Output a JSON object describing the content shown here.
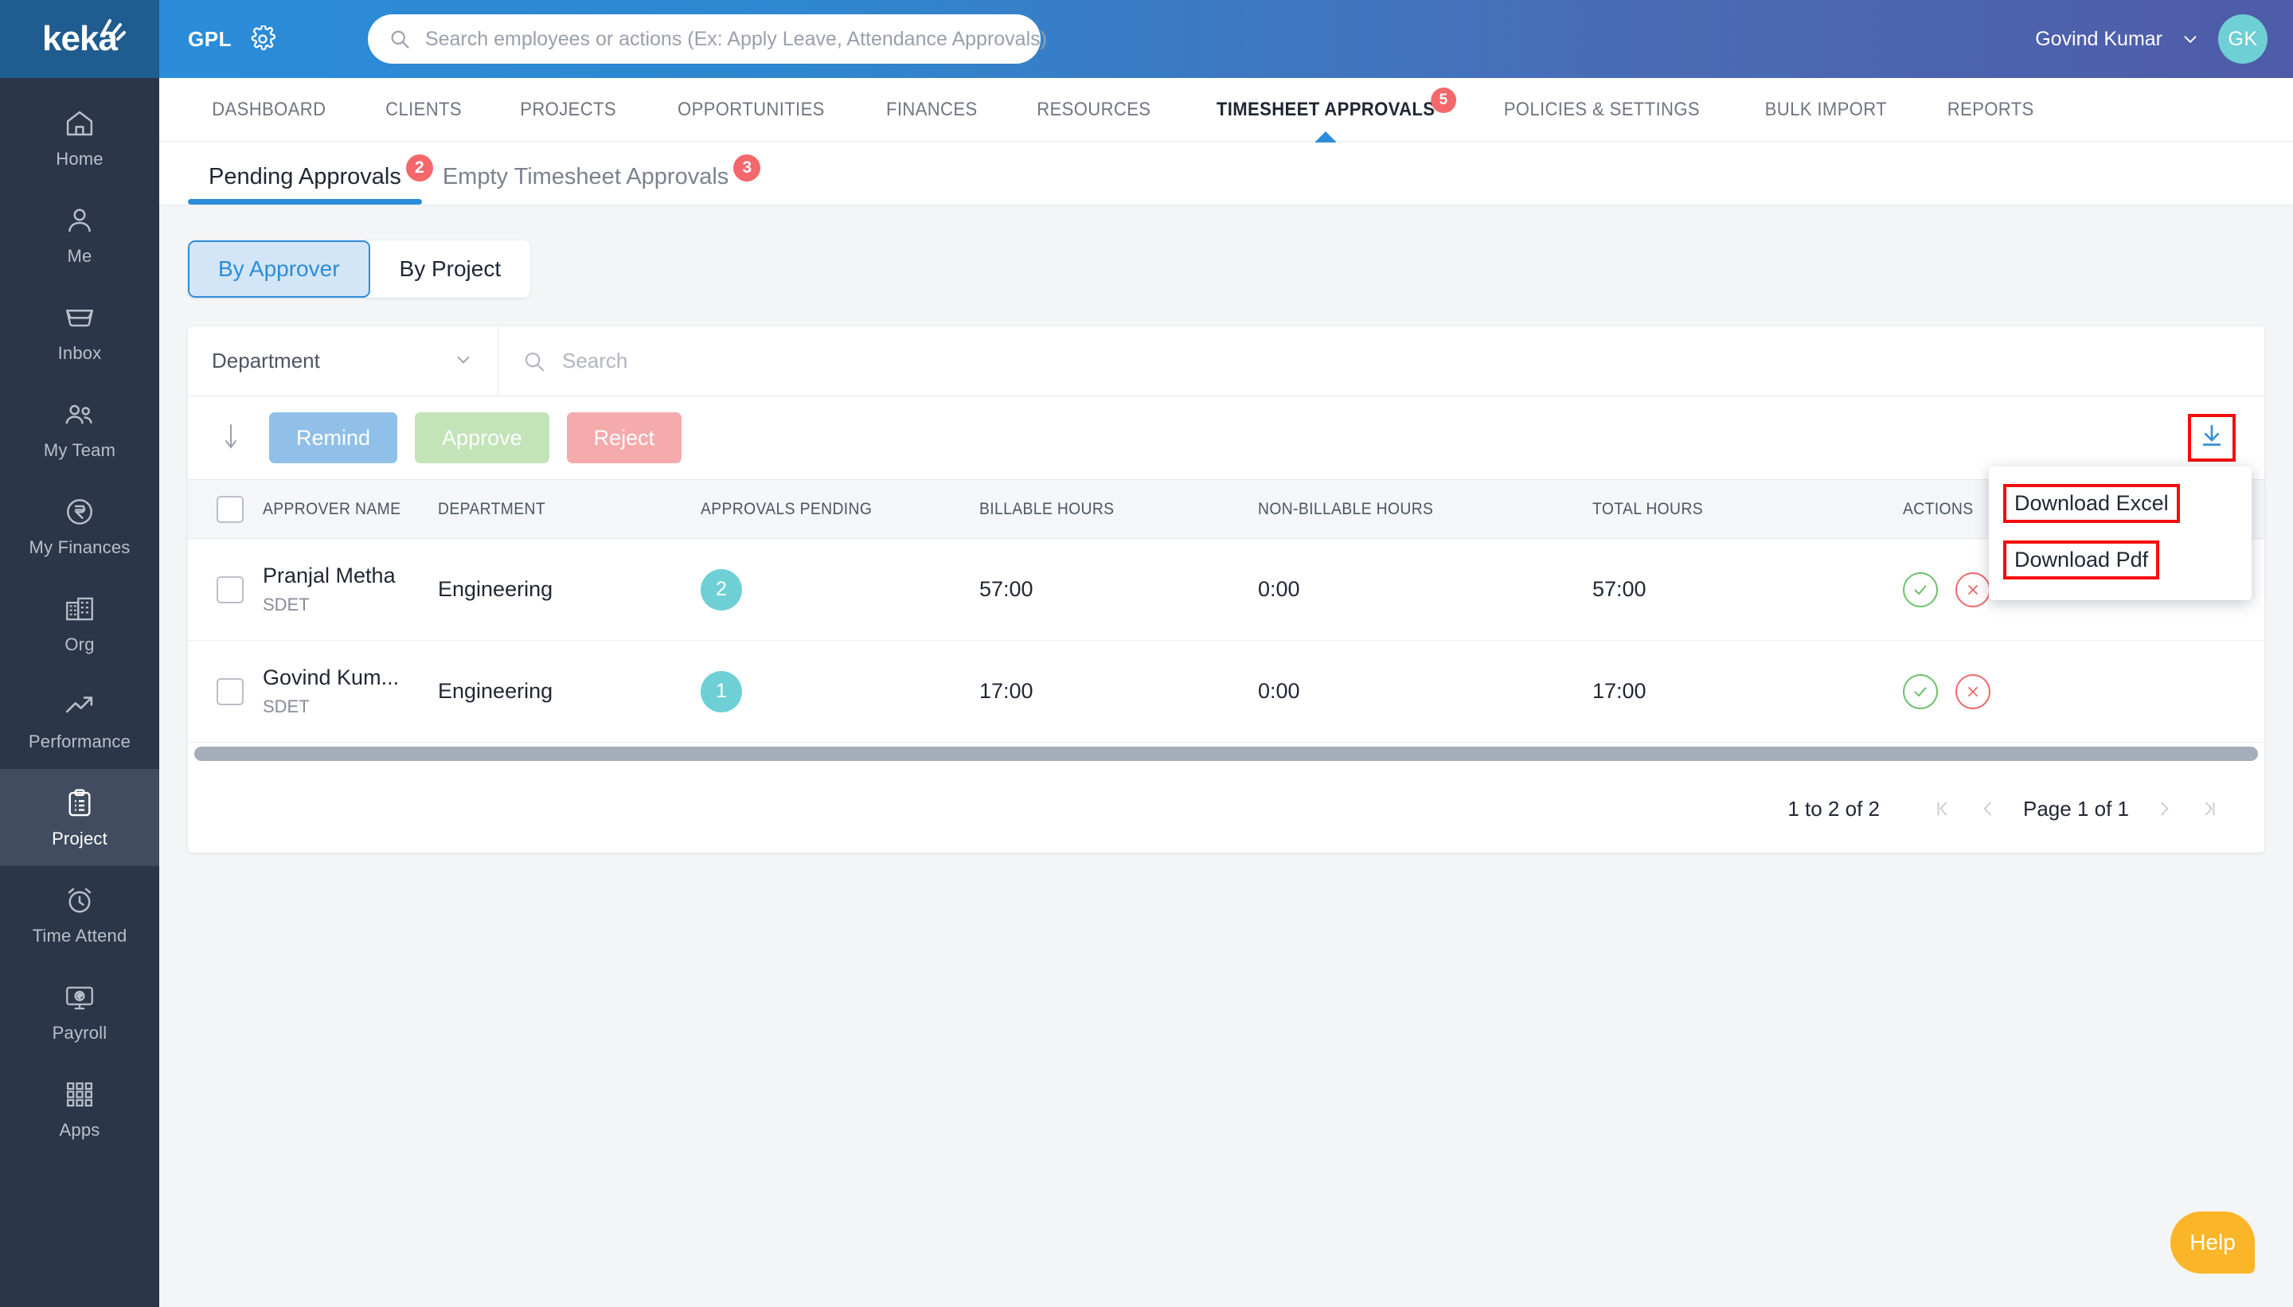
{
  "brand": {
    "logo_text": "keka",
    "org_code": "GPL",
    "gear_icon": "gear-icon"
  },
  "header": {
    "search_placeholder": "Search employees or actions (Ex: Apply Leave, Attendance Approvals)",
    "search_icon": "search-icon",
    "user_name": "Govind Kumar",
    "user_initials": "GK",
    "caret_icon": "chevron-down-icon"
  },
  "sidebar": {
    "items": [
      {
        "label": "Home",
        "icon": "home-icon",
        "active": false
      },
      {
        "label": "Me",
        "icon": "person-icon",
        "active": false
      },
      {
        "label": "Inbox",
        "icon": "inbox-tray-icon",
        "active": false
      },
      {
        "label": "My Team",
        "icon": "people-group-icon",
        "active": false
      },
      {
        "label": "My Finances",
        "icon": "rupee-circle-icon",
        "active": false
      },
      {
        "label": "Org",
        "icon": "building-icon",
        "active": false
      },
      {
        "label": "Performance",
        "icon": "trending-up-icon",
        "active": false
      },
      {
        "label": "Project",
        "icon": "clipboard-list-icon",
        "active": true
      },
      {
        "label": "Time Attend",
        "icon": "alarm-clock-icon",
        "active": false
      },
      {
        "label": "Payroll",
        "icon": "monitor-rupee-icon",
        "active": false
      },
      {
        "label": "Apps",
        "icon": "grid-dots-icon",
        "active": false
      }
    ]
  },
  "main_nav": {
    "items": [
      {
        "label": "DASHBOARD",
        "active": false,
        "badge": ""
      },
      {
        "label": "CLIENTS",
        "active": false,
        "badge": ""
      },
      {
        "label": "PROJECTS",
        "active": false,
        "badge": ""
      },
      {
        "label": "OPPORTUNITIES",
        "active": false,
        "badge": ""
      },
      {
        "label": "FINANCES",
        "active": false,
        "badge": ""
      },
      {
        "label": "RESOURCES",
        "active": false,
        "badge": ""
      },
      {
        "label": "TIMESHEET APPROVALS",
        "active": true,
        "badge": "5"
      },
      {
        "label": "POLICIES & SETTINGS",
        "active": false,
        "badge": ""
      },
      {
        "label": "BULK IMPORT",
        "active": false,
        "badge": ""
      },
      {
        "label": "REPORTS",
        "active": false,
        "badge": ""
      }
    ]
  },
  "sub_tabs": [
    {
      "label": "Pending Approvals",
      "badge": "2",
      "active": true
    },
    {
      "label": "Empty Timesheet Approvals",
      "badge": "3",
      "active": false
    }
  ],
  "segmented": [
    {
      "label": "By Approver",
      "active": true
    },
    {
      "label": "By Project",
      "active": false
    }
  ],
  "filters": {
    "department_label": "Department",
    "department_caret_icon": "chevron-down-icon",
    "search_placeholder": "Search",
    "search_icon": "search-icon"
  },
  "toolbar": {
    "bulk_arrow_icon": "curved-down-arrow-icon",
    "remind_label": "Remind",
    "approve_label": "Approve",
    "reject_label": "Reject",
    "download_icon": "download-arrow-icon"
  },
  "download_menu": {
    "open": true,
    "items": [
      {
        "label": "Download Excel",
        "highlighted": true
      },
      {
        "label": "Download Pdf",
        "highlighted": true
      }
    ]
  },
  "table": {
    "columns": [
      "APPROVER NAME",
      "DEPARTMENT",
      "APPROVALS PENDING",
      "BILLABLE HOURS",
      "NON-BILLABLE HOURS",
      "TOTAL HOURS",
      "ACTIONS"
    ],
    "rows": [
      {
        "name": "Pranjal Metha",
        "designation": "SDET",
        "department": "Engineering",
        "approvals_pending": "2",
        "billable_hours": "57:00",
        "non_billable_hours": "0:00",
        "total_hours": "57:00",
        "approve_icon": "check-circle-icon",
        "reject_icon": "x-circle-icon"
      },
      {
        "name": "Govind Kum...",
        "designation": "SDET",
        "department": "Engineering",
        "approvals_pending": "1",
        "billable_hours": "17:00",
        "non_billable_hours": "0:00",
        "total_hours": "17:00",
        "approve_icon": "check-circle-icon",
        "reject_icon": "x-circle-icon"
      }
    ]
  },
  "pagination": {
    "range_text": "1 to 2 of 2",
    "first_icon": "first-page-icon",
    "prev_icon": "prev-page-icon",
    "page_label": "Page 1 of 1",
    "next_icon": "next-page-icon",
    "last_icon": "last-page-icon"
  },
  "help": {
    "label": "Help"
  },
  "colors": {
    "brand_blue": "#2b8cd9",
    "sidebar_dark": "#2b3649",
    "badge_red": "#f4676b",
    "teal_pill": "#6ecfd4",
    "remind_blue": "#90c0e8",
    "approve_green": "#c3e3b8",
    "reject_red": "#f5aaab",
    "annotation_red": "#f40d0d",
    "help_amber": "#fbb528"
  }
}
